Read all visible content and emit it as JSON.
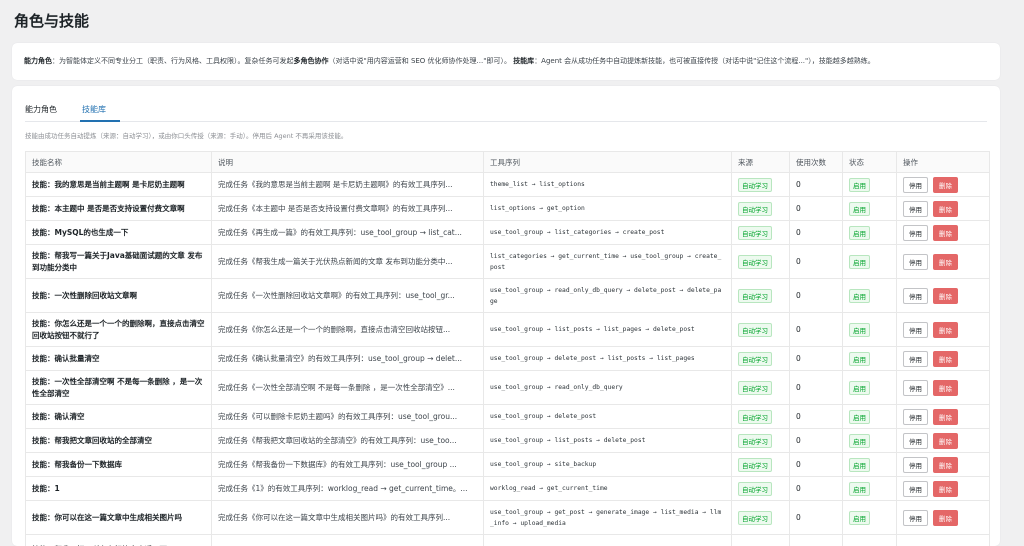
{
  "page": {
    "title": "角色与技能"
  },
  "info": {
    "roles_label": "能力角色",
    "roles_text": "：为智能体定义不同专业分工（职责、行为风格、工具权限）。复杂任务可发起",
    "collab_label": "多角色协作",
    "collab_text": "（对话中说\"用内容运营和 SEO 优化师协作处理...\"即可）。",
    "skills_label": "技能库",
    "skills_text": "：Agent 会从成功任务中自动提炼新技能，也可被直接传授（对话中说\"记住这个流程...\"），技能越多越熟练。"
  },
  "tabs": [
    {
      "label": "能力角色",
      "active": false
    },
    {
      "label": "技能库",
      "active": true
    }
  ],
  "hint": "技能由成功任务自动提炼（来源：自动学习），或由你口头传授（来源：手动）。停用后 Agent 不再采用该技能。",
  "table": {
    "headers": [
      "技能名称",
      "说明",
      "工具序列",
      "来源",
      "使用次数",
      "状态",
      "操作"
    ],
    "disable_label": "停用",
    "delete_label": "删除",
    "rows": [
      {
        "name": "技能：我的意思是当前主题啊 是卡尼奶主题啊",
        "desc": "完成任务《我的意思是当前主题啊 是卡尼奶主题啊》的有效工具序列...",
        "tools": "theme_list → list_options",
        "source": "自动学习",
        "uses": "0",
        "status": "启用"
      },
      {
        "name": "技能：本主题中 是否是否支持设置付费文章啊",
        "desc": "完成任务《本主题中 是否是否支持设置付费文章啊》的有效工具序列...",
        "tools": "list_options → get_option",
        "source": "自动学习",
        "uses": "0",
        "status": "启用"
      },
      {
        "name": "技能：MySQL的也生成一下",
        "desc": "完成任务《再生成一篇》的有效工具序列：use_tool_group → list_cat...",
        "tools": "use_tool_group → list_categories → create_post",
        "source": "自动学习",
        "uses": "0",
        "status": "启用"
      },
      {
        "name": "技能：帮我写一篇关于Java基础面试题的文章 发布到功能分类中",
        "desc": "完成任务《帮我生成一篇关于光伏热点新闻的文章 发布到功能分类中...",
        "tools": "list_categories → get_current_time → use_tool_group → create_post",
        "source": "自动学习",
        "uses": "0",
        "status": "启用"
      },
      {
        "name": "技能：一次性删除回收站文章啊",
        "desc": "完成任务《一次性删除回收站文章啊》的有效工具序列：use_tool_gr...",
        "tools": "use_tool_group → read_only_db_query → delete_post → delete_page",
        "source": "自动学习",
        "uses": "0",
        "status": "启用"
      },
      {
        "name": "技能：你怎么还是一个一个的删除啊，直接点击清空回收站按钮不就行了",
        "desc": "完成任务《你怎么还是一个一个的删除啊，直接点击清空回收站按钮...",
        "tools": "use_tool_group → list_posts → list_pages → delete_post",
        "source": "自动学习",
        "uses": "0",
        "status": "启用"
      },
      {
        "name": "技能：确认批量清空",
        "desc": "完成任务《确认批量清空》的有效工具序列：use_tool_group → delet...",
        "tools": "use_tool_group → delete_post → list_posts → list_pages",
        "source": "自动学习",
        "uses": "0",
        "status": "启用"
      },
      {
        "name": "技能：一次性全部清空啊 不是每一条删除 ，是一次性全部清空",
        "desc": "完成任务《一次性全部清空啊 不是每一条删除 ，是一次性全部清空》...",
        "tools": "use_tool_group → read_only_db_query",
        "source": "自动学习",
        "uses": "0",
        "status": "启用"
      },
      {
        "name": "技能：确认清空",
        "desc": "完成任务《可以删除卡尼奶主题吗》的有效工具序列：use_tool_grou...",
        "tools": "use_tool_group → delete_post",
        "source": "自动学习",
        "uses": "0",
        "status": "启用"
      },
      {
        "name": "技能：帮我把文章回收站的全部清空",
        "desc": "完成任务《帮我把文章回收站的全部清空》的有效工具序列：use_too...",
        "tools": "use_tool_group → list_posts → delete_post",
        "source": "自动学习",
        "uses": "0",
        "status": "启用"
      },
      {
        "name": "技能：帮我备份一下数据库",
        "desc": "完成任务《帮我备份一下数据库》的有效工具序列：use_tool_group ...",
        "tools": "use_tool_group → site_backup",
        "source": "自动学习",
        "uses": "0",
        "status": "启用"
      },
      {
        "name": "技能：1",
        "desc": "完成任务《1》的有效工具序列：worklog_read → get_current_time。...",
        "tools": "worklog_read → get_current_time",
        "source": "自动学习",
        "uses": "0",
        "status": "启用"
      },
      {
        "name": "技能：你可以在这一篇文章中生成相关图片吗",
        "desc": "完成任务《你可以在这一篇文章中生成相关图片吗》的有效工具序列...",
        "tools": "use_tool_group → get_post → generate_image → list_media → llm_info → upload_media",
        "source": "自动学习",
        "uses": "0",
        "status": "启用"
      },
      {
        "name": "技能：帮我…把…所有在标签中合适…可…",
        "desc": "",
        "tools": "use_tool_group → list_categories → theme_list → get_site_inf",
        "source": "",
        "uses": "",
        "status": ""
      }
    ]
  }
}
